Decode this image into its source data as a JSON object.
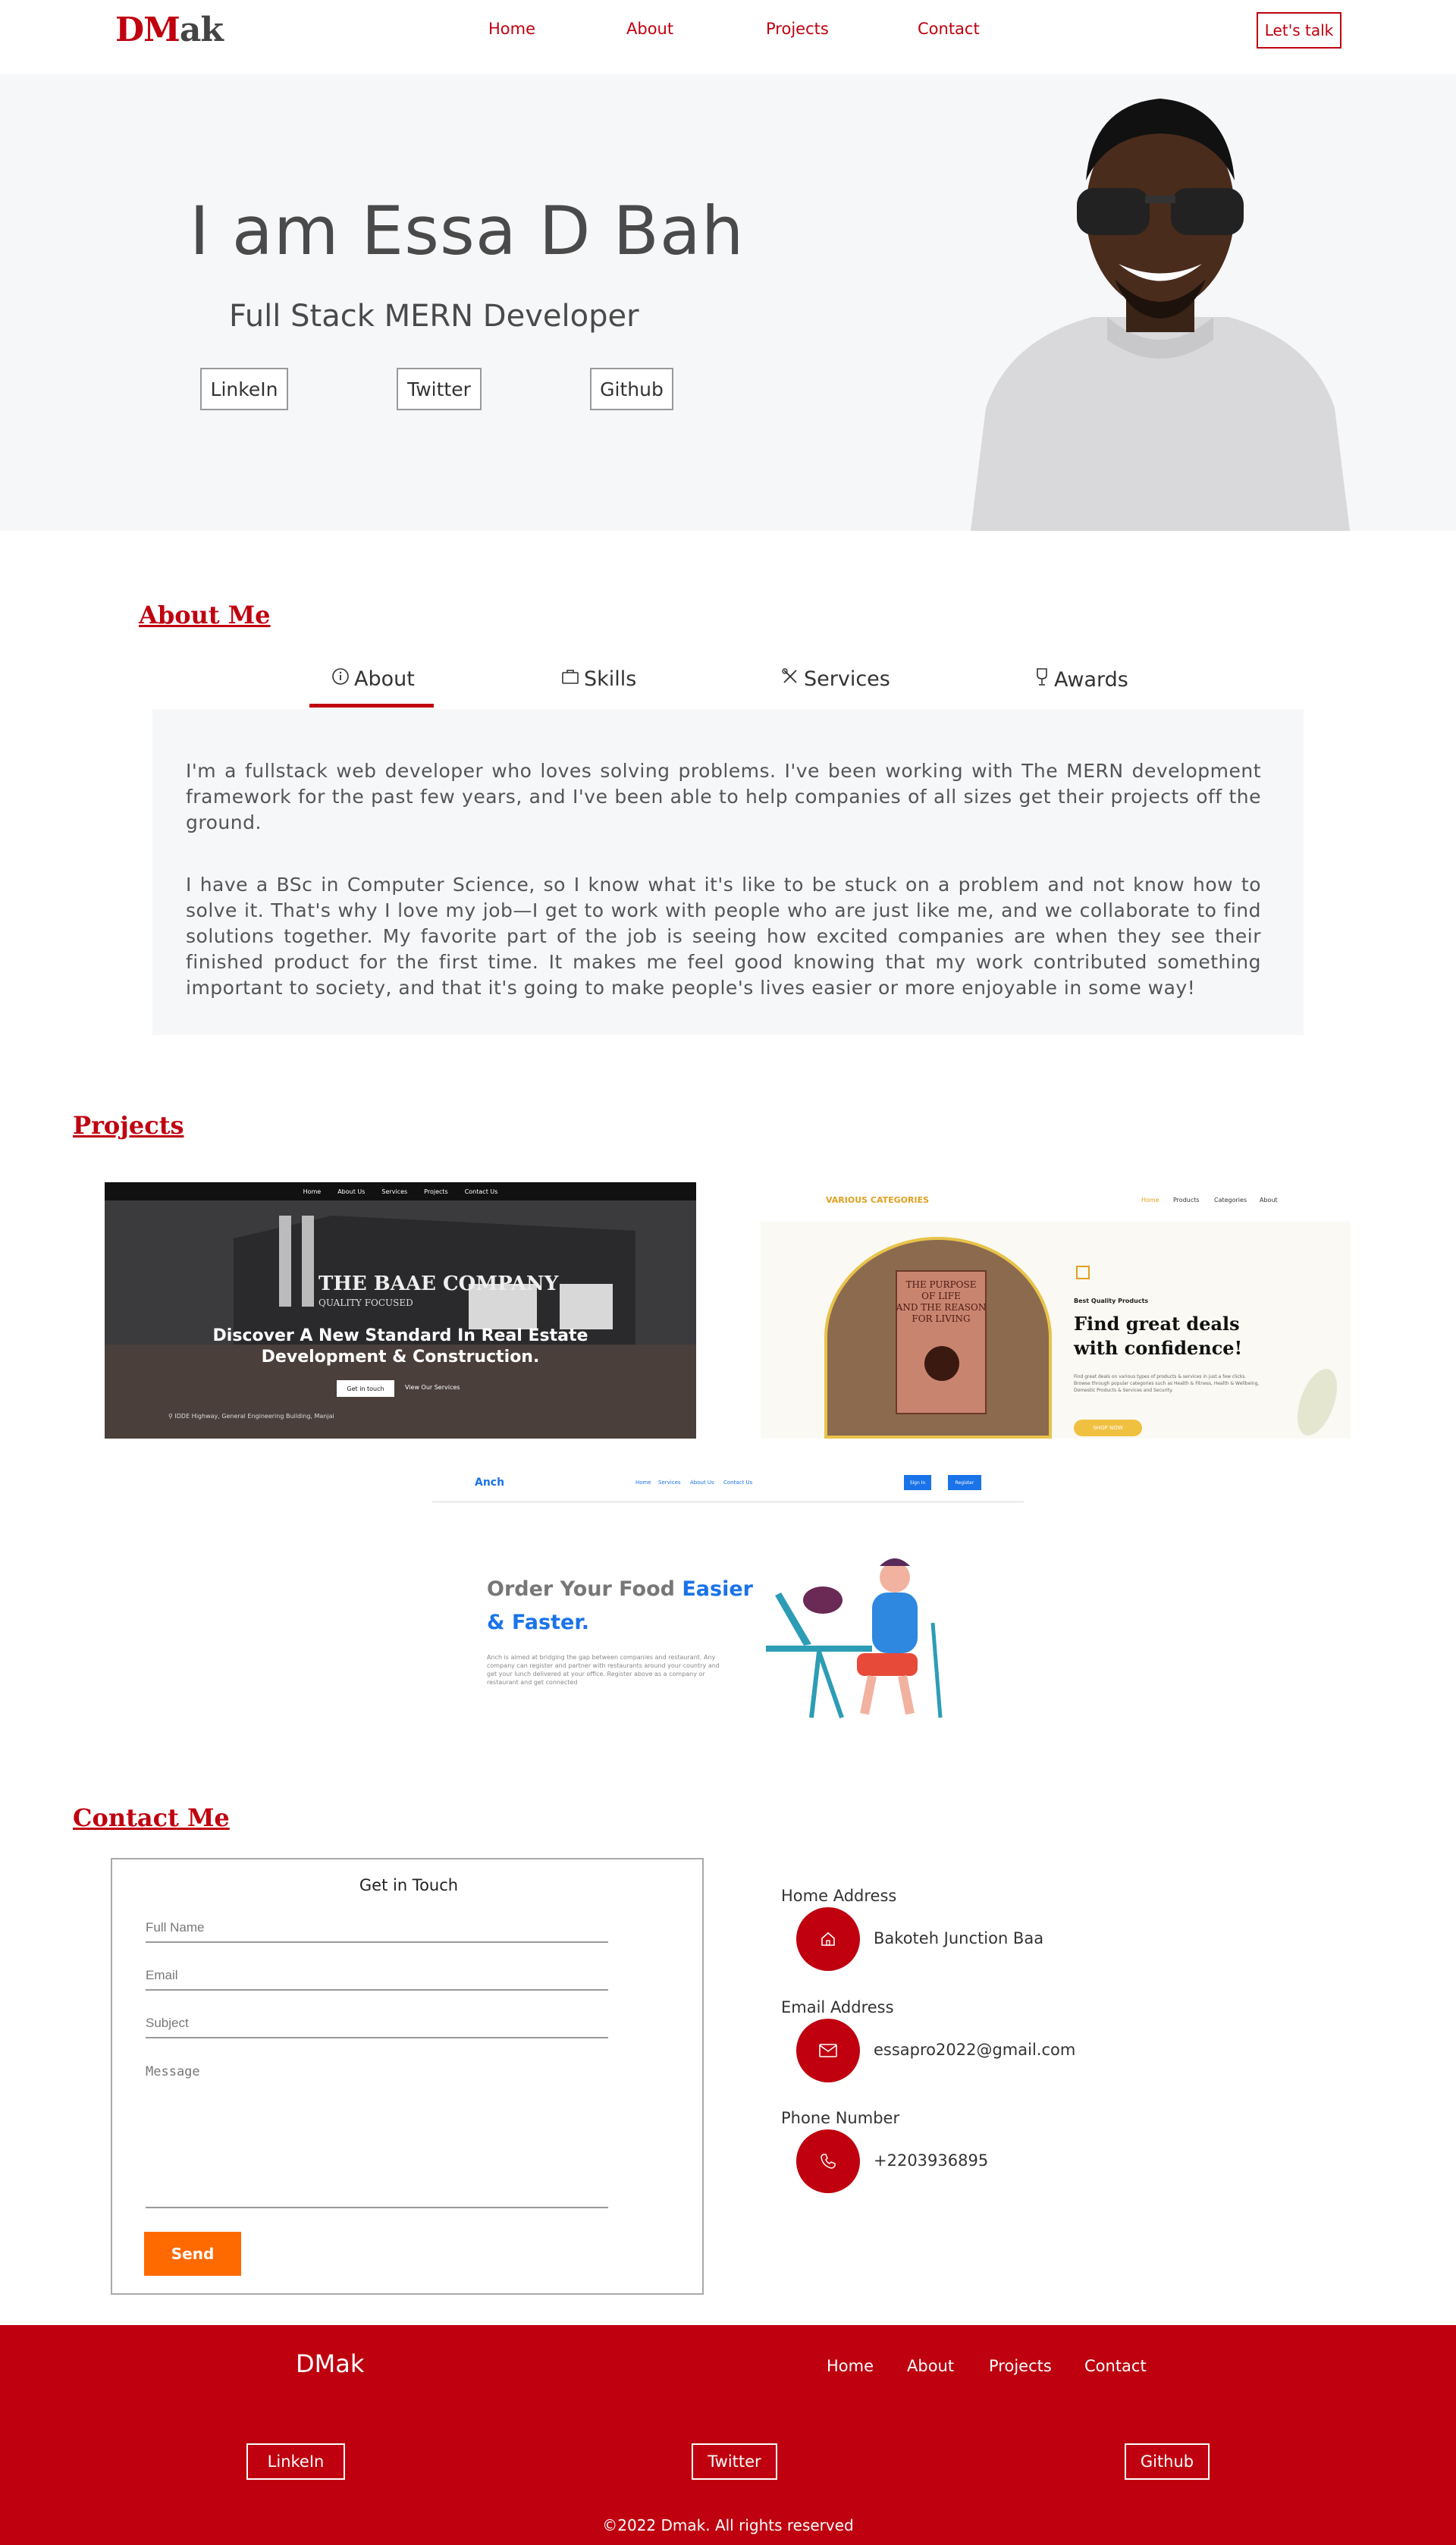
{
  "header": {
    "logo_a": "DM",
    "logo_b": "ak",
    "nav": [
      "Home",
      "About",
      "Projects",
      "Contact"
    ],
    "cta": "Let's talk"
  },
  "hero": {
    "title": "I am Essa D Bah",
    "subtitle": "Full Stack MERN Developer",
    "links": [
      "LinkeIn",
      "Twitter",
      "Github"
    ]
  },
  "about": {
    "heading": "About Me",
    "tabs": [
      "About",
      "Skills",
      "Services",
      "Awards"
    ],
    "para1": "I'm a fullstack web developer who loves solving problems. I've been working with The MERN development framework for the past few years, and I've been able to help companies of all sizes get their projects off the ground.",
    "para2": "I have a BSc in Computer Science, so I know what it's like to be stuck on a problem and not know how to solve it. That's why I love my job—I get to work with people who are just like me, and we collaborate to find solutions together. My favorite part of the job is seeing how excited companies are when they see their finished product for the first time. It makes me feel good knowing that my work contributed something important to society, and that it's going to make people's lives easier or more enjoyable in some way!"
  },
  "projects": {
    "heading": "Projects",
    "p1": {
      "nav": [
        "Home",
        "About Us",
        "Services",
        "Projects",
        "Contact Us"
      ],
      "company": "THE BAAE COMPANY",
      "tag": "QUALITY FOCUSED",
      "headline1": "Discover A New Standard In Real Estate",
      "headline2": "Development & Construction.",
      "btn1": "Get in touch",
      "btn2": "View Our Services",
      "address": "IDDE Highway, General Engineering Building, Manjai"
    },
    "p2": {
      "brand": "VARIOUS CATEGORIES",
      "nav": [
        "Home",
        "Products",
        "Categories",
        "About"
      ],
      "book1": "THE PURPOSE",
      "book2": "OF LIFE",
      "book3": "AND THE REASON",
      "book4": "FOR LIVING",
      "eyebrow": "Best Quality Products",
      "headline1": "Find great deals",
      "headline2": "with confidence!",
      "body": "Find great deals on various types of products & services in just a few clicks. Browse through popular categories such as Health & Fitness, Health & Wellbeing, Domestic Products & Services and Security.",
      "btn": "SHOP NOW"
    },
    "p3": {
      "brand": "Anch",
      "nav": [
        "Home",
        "Services",
        "About Us",
        "Contact Us"
      ],
      "btn1": "Sign In",
      "btn2": "Register",
      "headline1a": "Order Your Food ",
      "headline1b": "Easier",
      "headline2": "& Faster.",
      "body": "Anch is aimed at bridging the gap between companies and restaurant. Any company can register and partner with restaurants around your country and get your lunch delivered at your office. Register above as a company or restaurant and get connected"
    }
  },
  "contact": {
    "heading": "Contact Me",
    "form_title": "Get in Touch",
    "name_ph": "Full Name",
    "email_ph": "Email",
    "subject_ph": "Subject",
    "message_ph": "Message",
    "send": "Send",
    "home_label": "Home Address",
    "home_val": "Bakoteh Junction Baa",
    "email_label": "Email Address",
    "email_val": "essapro2022@gmail.com",
    "phone_label": "Phone Number",
    "phone_val": "+2203936895"
  },
  "footer": {
    "logo": "DMak",
    "nav": [
      "Home",
      "About",
      "Projects",
      "Contact"
    ],
    "links": [
      "LinkeIn",
      "Twitter",
      "Github"
    ],
    "copy": "©2022 Dmak. All rights reserved"
  },
  "colors": {
    "brand": "#c0000f",
    "accent": "#ff6a00",
    "bg_light": "#f6f7f9"
  }
}
